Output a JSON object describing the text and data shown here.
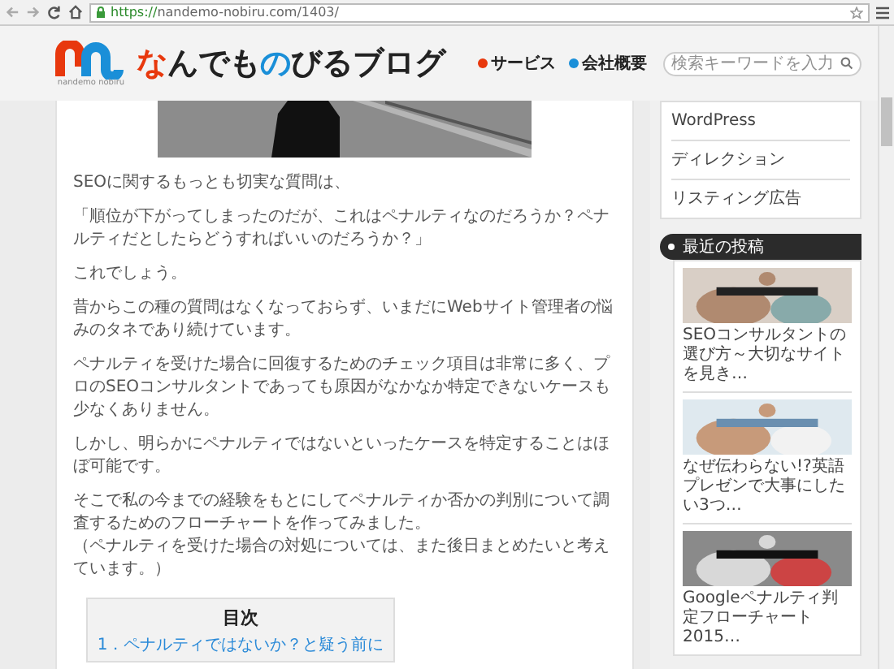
{
  "browser": {
    "url_scheme": "https://",
    "url_rest": "nandemo-nobiru.com/1403/"
  },
  "header": {
    "logo_parts": [
      {
        "text": "な",
        "color": "#e8380d"
      },
      {
        "text": "んでも",
        "color": "#222222"
      },
      {
        "text": "の",
        "color": "#1a8fd8"
      },
      {
        "text": "びるブログ",
        "color": "#222222"
      }
    ],
    "logo_caption": "nandemo nobiru",
    "nav": [
      {
        "label": "サービス",
        "color": "#e8380d"
      },
      {
        "label": "会社概要",
        "color": "#1a8fd8"
      }
    ],
    "search": {
      "placeholder": "検索キーワードを入力"
    }
  },
  "article": {
    "paragraphs": [
      [
        "SEOに関するもっとも切実な質問は、"
      ],
      [
        "「順位が下がってしまったのだが、これはペナルティなのだろうか？ペナルティだとしたらどうすればいいのだろうか？」"
      ],
      [
        "これでしょう。"
      ],
      [
        "昔からこの種の質問はなくなっておらず、いまだにWebサイト管理者の悩みのタネであり続けています。"
      ],
      [
        "ペナルティを受けた場合に回復するためのチェック項目は非常に多く、プロのSEOコンサルタントであっても原因がなかなか特定できないケースも少なくありません。"
      ],
      [
        "しかし、明らかにペナルティではないといったケースを特定することはほぼ可能です。"
      ],
      [
        "そこで私の今までの経験をもとにしてペナルティか否かの判別について調査するためのフローチャートを作ってみました。",
        "（ペナルティを受けた場合の対処については、また後日まとめたいと考えています。）"
      ]
    ],
    "toc": {
      "title": "目次",
      "items": [
        "1．ペナルティではないか？と疑う前に"
      ]
    }
  },
  "sidebar": {
    "menu": [
      "WordPress",
      "ディレクション",
      "リスティング広告"
    ],
    "recent": {
      "title": "最近の投稿",
      "posts": [
        {
          "caption": "SEOコンサルタントの選び方～大切なサイトを見き…",
          "kind": "picture"
        },
        {
          "caption": "なぜ伝わらない!?英語プレゼンで大事にしたい3つ…",
          "kind": "picture"
        },
        {
          "caption": "Googleペナルティ判定フローチャート2015…",
          "kind": "picture"
        }
      ]
    }
  }
}
